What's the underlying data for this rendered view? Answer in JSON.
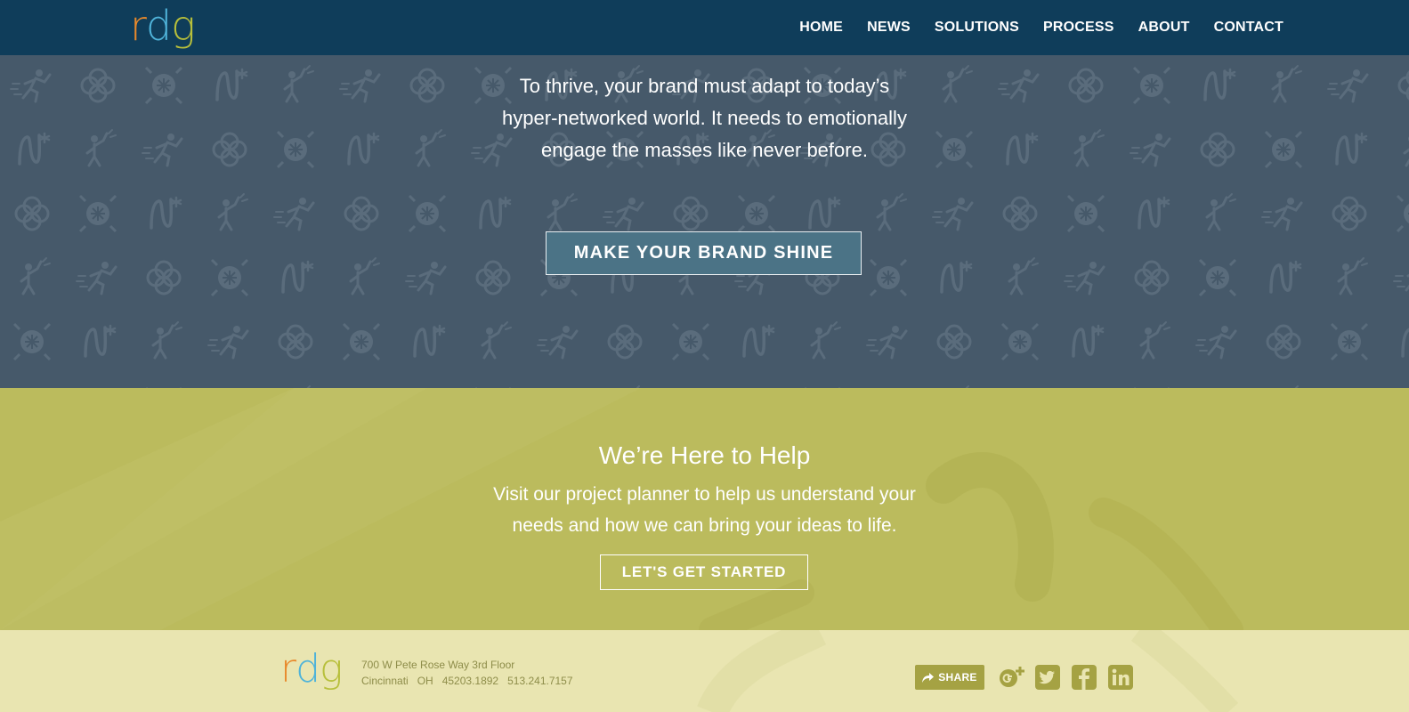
{
  "header": {
    "logo": {
      "r": "r",
      "d": "d",
      "g": "g"
    },
    "nav": [
      {
        "label": "HOME"
      },
      {
        "label": "NEWS"
      },
      {
        "label": "SOLUTIONS"
      },
      {
        "label": "PROCESS"
      },
      {
        "label": "ABOUT"
      },
      {
        "label": "CONTACT"
      }
    ]
  },
  "hero": {
    "lines": [
      "To thrive, your brand must adapt to today’s",
      "hyper-networked world. It needs to emotionally",
      "engage the masses like never before."
    ],
    "button_label": "MAKE YOUR BRAND SHINE"
  },
  "help": {
    "title": "We’re Here to Help",
    "lines": [
      "Visit our project planner to help us understand your",
      "needs and how we can bring your ideas to life."
    ],
    "button_label": "LET'S GET STARTED"
  },
  "footer": {
    "address_line1": "700 W Pete Rose Way 3rd Floor",
    "city": "Cincinnati",
    "state": "OH",
    "zip": "45203.1892",
    "phone": "513.241.7157",
    "share_label": "SHARE",
    "social_icons": [
      "google-plus-icon",
      "twitter-icon",
      "facebook-icon",
      "linkedin-icon"
    ]
  },
  "colors": {
    "header_bg": "#0f3d5a",
    "hero_bg": "#46596a",
    "hero_button": "#4b7386",
    "help_bg": "#bbbb5d",
    "footer_bg": "#e9e5b1",
    "footer_accent": "#a5a243",
    "logo_r": "#e8892b",
    "logo_d": "#4fb3d9",
    "logo_g": "#b7bf3b"
  }
}
